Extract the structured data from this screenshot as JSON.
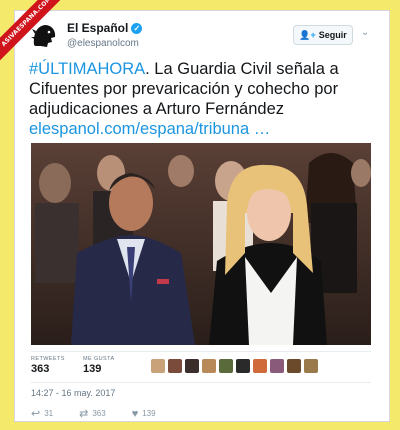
{
  "watermark": {
    "text": "ASIVAESPANA.COM"
  },
  "account": {
    "name": "El Español",
    "handle": "@elespanolcom",
    "logo_icon": "lion-head-logo",
    "verified_icon": "verified-badge-icon"
  },
  "header": {
    "follow_label": "Seguir",
    "follow_icon": "add-person-icon",
    "more_icon": "chevron-down-icon"
  },
  "tweet": {
    "hashtag": "#ÚLTIMAHORA",
    "text": ". La Guardia Civil señala a Cifuentes por prevaricación y cohecho por adjudicaciones a Arturo Fernández ",
    "link": "elespanol.com/espana/tribuna …"
  },
  "stats": {
    "retweets_label": "RETWEETS",
    "retweets_value": "363",
    "likes_label": "ME GUSTA",
    "likes_value": "139",
    "liker_avatar_count": 10
  },
  "timestamp": "14:27 - 16 may. 2017",
  "actions": {
    "reply_count": "31",
    "retweet_count": "363",
    "like_count": "139"
  },
  "colors": {
    "background": "#f4e96a",
    "accent": "#1da1f2",
    "ribbon": "#d0141c"
  }
}
